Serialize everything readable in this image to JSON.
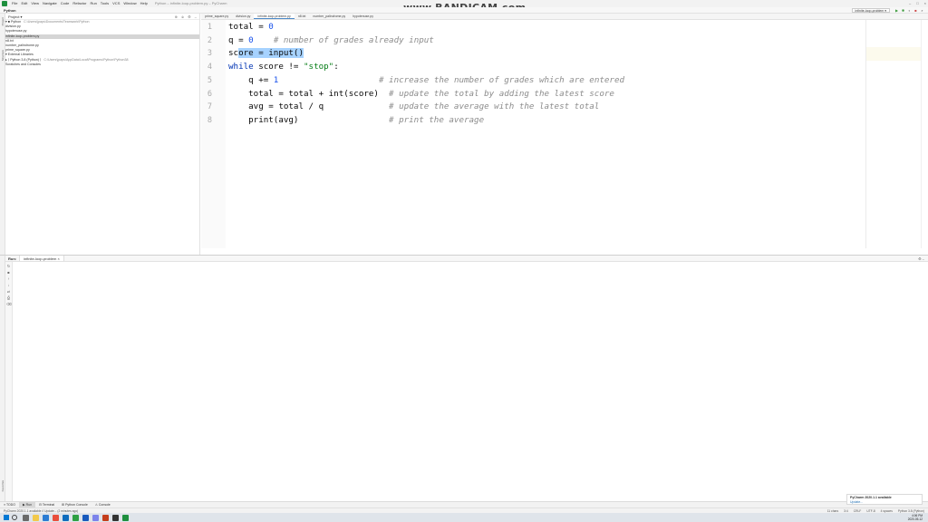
{
  "window": {
    "title": "Python – infinite-loop-problem.py – PyCharm",
    "menu": [
      "File",
      "Edit",
      "View",
      "Navigate",
      "Code",
      "Refactor",
      "Run",
      "Tools",
      "VCS",
      "Window",
      "Help"
    ]
  },
  "watermark": "www.BANDICAM.com",
  "navbar": {
    "crumb": "Python",
    "run_config": "infinite-loop-problem ▾"
  },
  "toolstrip": [
    "Project",
    "Structure",
    "Favorites"
  ],
  "project": {
    "header": "Project ▾",
    "items": [
      {
        "label": "▾ ■ Python",
        "path": "C:\\Users\\jpaps\\Documents\\Teamwork\\Python"
      },
      {
        "label": "     division.py",
        "path": ""
      },
      {
        "label": "     hypotenuse.py",
        "path": ""
      },
      {
        "label": "     infinite-loop-problem.py",
        "path": ""
      },
      {
        "label": "     n8.txt",
        "path": ""
      },
      {
        "label": "     number_palindrome.py",
        "path": ""
      },
      {
        "label": "     prime_square.py",
        "path": ""
      },
      {
        "label": "▾ External Libraries",
        "path": ""
      },
      {
        "label": "  ▸ ⟨ Python 3.8 (Python) ⟩",
        "path": "C:\\Users\\jpaps\\AppData\\Local\\Programs\\Python\\Python38"
      },
      {
        "label": "     Scratches and Consoles",
        "path": ""
      }
    ]
  },
  "tabs": [
    "prime_square.py",
    "division.py",
    "infinite-loop-problem.py",
    "n8.txt",
    "number_palindrome.py",
    "hypotenuse.py"
  ],
  "code": {
    "line_numbers": [
      "1",
      "2",
      "3",
      "4",
      "5",
      "6",
      "7",
      "8"
    ],
    "l1": {
      "a": "total = ",
      "b": "0"
    },
    "l2": {
      "a": "q = ",
      "b": "0",
      "c": "    # number of grades already input"
    },
    "l3": {
      "a": "sc",
      "b": "ore = input()"
    },
    "l4": {
      "a": "while",
      "b": " score != ",
      "c": "\"stop\"",
      "d": ":"
    },
    "l5": {
      "a": "    q += ",
      "b": "1",
      "c": "                    # increase the number of grades which are entered"
    },
    "l6": {
      "a": "    total = total + int(score)  ",
      "b": "# update the total by adding the latest score"
    },
    "l7": {
      "a": "    avg = total / q             ",
      "b": "# update the average with the latest total"
    },
    "l8": {
      "a": "    print(avg)                  ",
      "b": "# print the average"
    }
  },
  "run": {
    "label": "Run:",
    "tab": "infinite-loop-problem ×",
    "settings": "⚙ –"
  },
  "bottom_tabs": [
    "≡ TODO",
    "▶ Run",
    "⊟ Terminal",
    "⊞ Python Console",
    "⚠ Console"
  ],
  "notification": {
    "title": "PyCharm 2020.1.1 available",
    "link": "Update..."
  },
  "status": {
    "left": "PyCharm 2020.1.1 available // Update... (2 minutes ago)",
    "right": [
      "11 chars",
      "3:4",
      "CRLF",
      "UTF-8",
      "4 spaces",
      "Python 3.8 (Python)"
    ]
  },
  "taskbar": {
    "time": "4:06 PM",
    "date": "2020-05-12"
  },
  "colors": {
    "keyword": "#0033b3",
    "number": "#1750eb",
    "string": "#067d17",
    "comment": "#8c8c8c",
    "selection": "#a6d2ff"
  }
}
